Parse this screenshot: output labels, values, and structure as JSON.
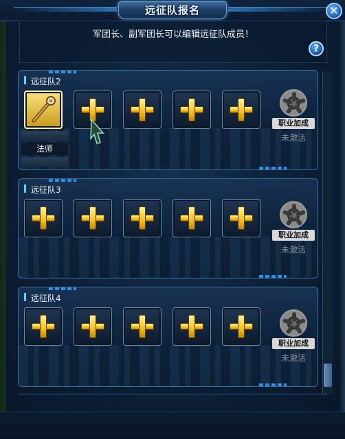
{
  "window": {
    "title": "远征队报名",
    "close_symbol": "✕",
    "help_symbol": "?"
  },
  "notice": "军团长、副军团长可以编辑远征队成员！",
  "teams": [
    {
      "label": "远征队2",
      "member_class": "法师",
      "bonus_label": "职业加成",
      "bonus_status": "未激活"
    },
    {
      "label": "远征队3",
      "bonus_label": "职业加成",
      "bonus_status": "未激活"
    },
    {
      "label": "远征队4",
      "bonus_label": "职业加成",
      "bonus_status": "未激活"
    }
  ],
  "icons": {
    "add": "plus-icon",
    "member": "staff-icon",
    "bonus": "aperture-icon",
    "close": "close-icon",
    "help": "question-icon"
  },
  "colors": {
    "accent": "#5fd0ff",
    "plus": "#f5c21a",
    "frame": "#3a6c9c"
  }
}
